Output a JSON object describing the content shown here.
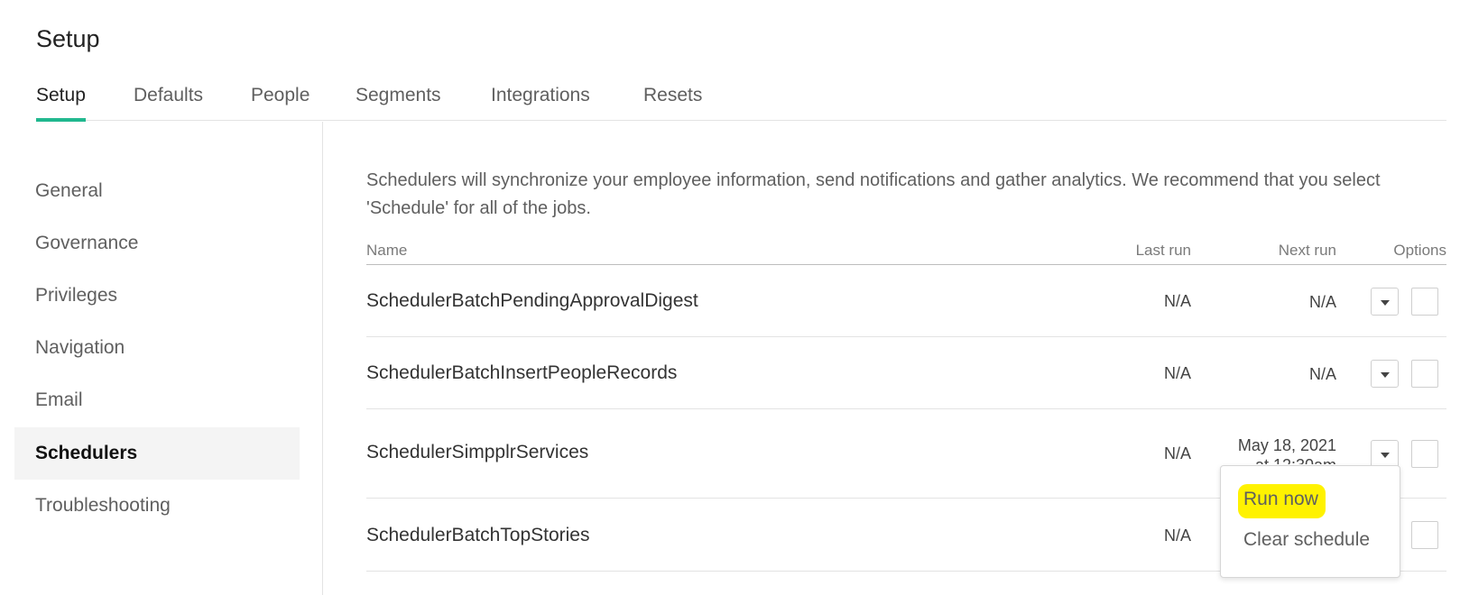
{
  "page": {
    "title": "Setup"
  },
  "tabs": [
    {
      "label": "Setup",
      "active": true
    },
    {
      "label": "Defaults"
    },
    {
      "label": "People"
    },
    {
      "label": "Segments"
    },
    {
      "label": "Integrations"
    },
    {
      "label": "Resets"
    }
  ],
  "sidebar": {
    "items": [
      {
        "label": "General"
      },
      {
        "label": "Governance"
      },
      {
        "label": "Privileges"
      },
      {
        "label": "Navigation"
      },
      {
        "label": "Email"
      },
      {
        "label": "Schedulers",
        "selected": true
      },
      {
        "label": "Troubleshooting"
      }
    ]
  },
  "main": {
    "intro": "Schedulers will synchronize your employee information, send notifications and gather analytics. We recommend that you select 'Schedule' for all of the jobs.",
    "table": {
      "headers": {
        "name": "Name",
        "last_run": "Last run",
        "next_run": "Next run",
        "options": "Options"
      },
      "rows": [
        {
          "name": "SchedulerBatchPendingApprovalDigest",
          "last_run": "N/A",
          "next_run": "N/A"
        },
        {
          "name": "SchedulerBatchInsertPeopleRecords",
          "last_run": "N/A",
          "next_run": "N/A"
        },
        {
          "name": "SchedulerSimpplrServices",
          "last_run": "N/A",
          "next_run": "May 18, 2021",
          "next_run_line2": "at 12:30am"
        },
        {
          "name": "SchedulerBatchTopStories",
          "last_run": "N/A",
          "next_run": ""
        }
      ]
    }
  },
  "dropdown": {
    "items": [
      {
        "label": "Run now",
        "highlighted": true
      },
      {
        "label": "Clear schedule"
      }
    ],
    "highlight_color": "#fff200"
  },
  "colors": {
    "accent": "#21b88f",
    "selected_bg": "#f4f4f4"
  },
  "icons": {
    "options_toggle": "caret-down-icon"
  }
}
